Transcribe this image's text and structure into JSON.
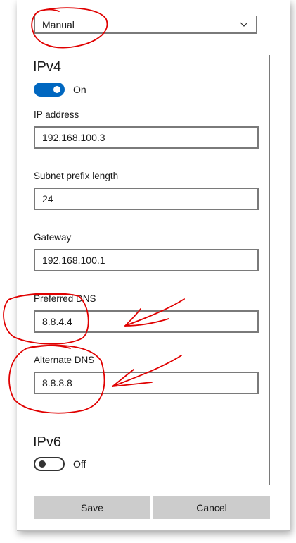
{
  "connection_mode": "Manual",
  "ipv4": {
    "title": "IPv4",
    "toggle_state": "On",
    "fields": {
      "ip_address": {
        "label": "IP address",
        "value": "192.168.100.3"
      },
      "subnet_prefix_length": {
        "label": "Subnet prefix length",
        "value": "24"
      },
      "gateway": {
        "label": "Gateway",
        "value": "192.168.100.1"
      },
      "preferred_dns": {
        "label": "Preferred DNS",
        "value": "8.8.4.4"
      },
      "alternate_dns": {
        "label": "Alternate DNS",
        "value": "8.8.8.8"
      }
    }
  },
  "ipv6": {
    "title": "IPv6",
    "toggle_state": "Off"
  },
  "buttons": {
    "save": "Save",
    "cancel": "Cancel"
  },
  "colors": {
    "accent": "#0067c0",
    "annotation": "#e00000",
    "button_bg": "#cccccc",
    "input_border": "#7a7a7a"
  },
  "icons": {
    "dropdown": "chevron-down-icon"
  }
}
